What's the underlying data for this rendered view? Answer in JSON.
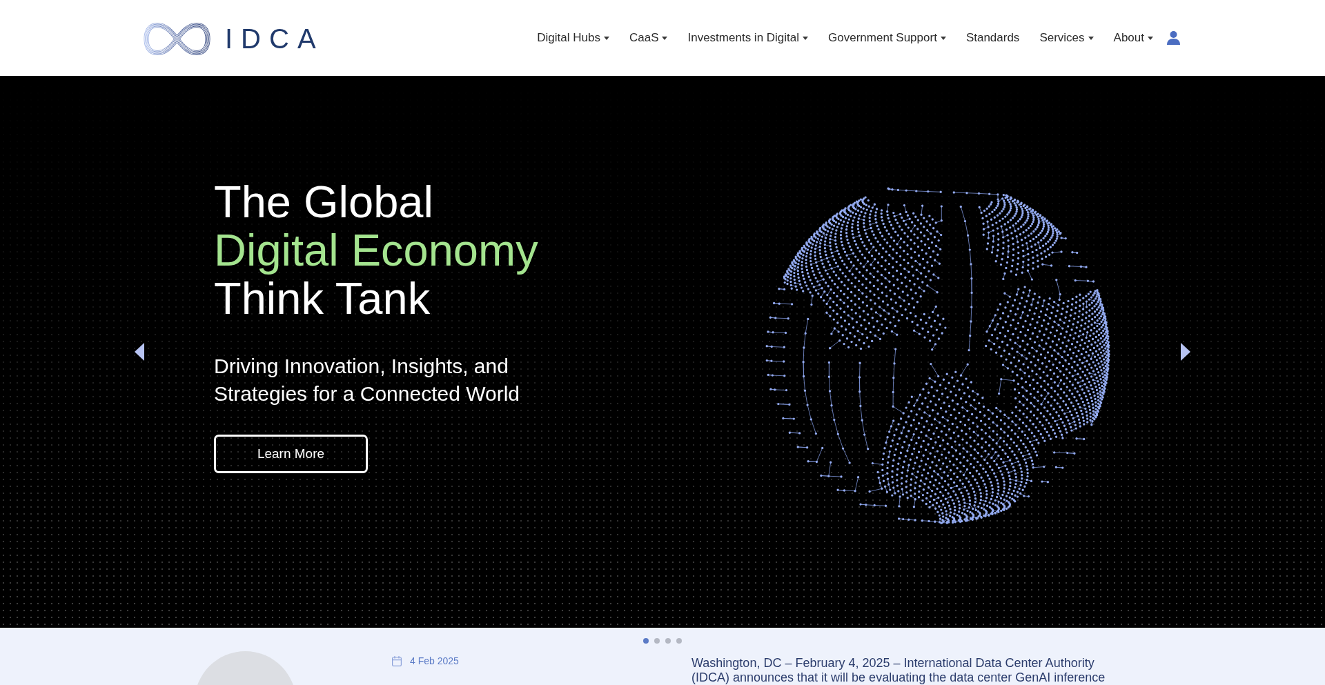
{
  "header": {
    "logo_text": "IDCA",
    "nav": [
      {
        "label": "Digital Hubs",
        "has_menu": true
      },
      {
        "label": "CaaS",
        "has_menu": true
      },
      {
        "label": "Investments in Digital",
        "has_menu": true
      },
      {
        "label": "Government Support",
        "has_menu": true
      },
      {
        "label": "Standards",
        "has_menu": false
      },
      {
        "label": "Services",
        "has_menu": true
      },
      {
        "label": "About",
        "has_menu": true
      }
    ]
  },
  "hero": {
    "headline": [
      {
        "text": "The Global",
        "highlight": false
      },
      {
        "text": "Digital Economy",
        "highlight": true
      },
      {
        "text": "Think Tank",
        "highlight": false
      }
    ],
    "subtitle": "Driving Innovation, Insights, and Strategies for a Connected World",
    "button": "Learn More"
  },
  "slide_indicators": [
    {
      "selected": true
    },
    {
      "selected": false
    },
    {
      "selected": false
    },
    {
      "selected": false
    }
  ],
  "news": {
    "date": "4 Feb 2025",
    "text": "Washington, DC – February 4, 2025 – International Data Center Authority (IDCA) announces that it will be evaluating the data center GenAI inference"
  }
}
